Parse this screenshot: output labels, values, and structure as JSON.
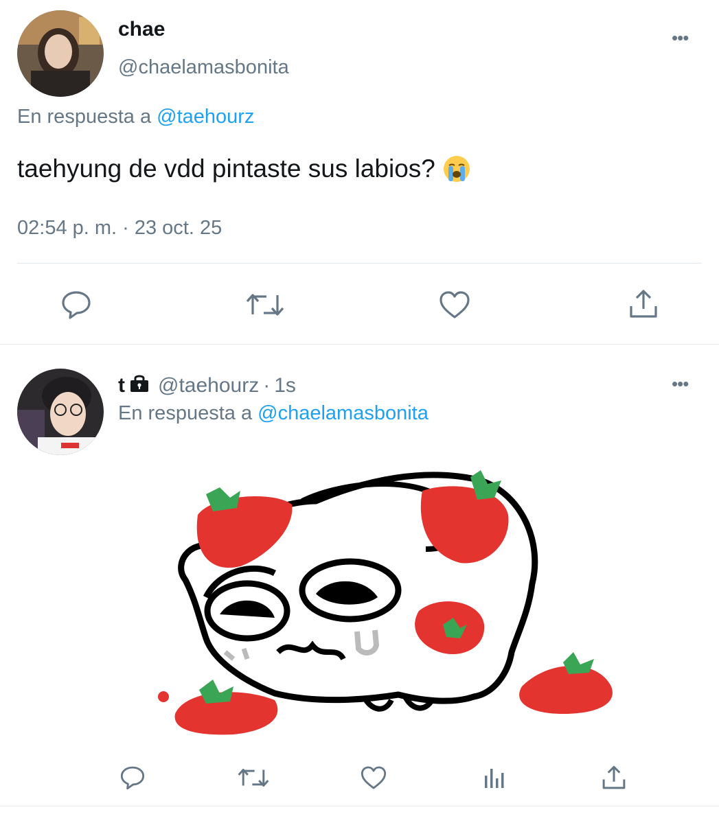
{
  "main_tweet": {
    "author_name": "chae",
    "author_handle": "@chaelamasbonita",
    "reply_prefix": "En respuesta a",
    "reply_to": "@taehourz",
    "text": "taehyung de vdd pintaste sus labios?",
    "emoji": "loudly-crying-face",
    "timestamp": "02:54 p. m. · 23 oct. 25",
    "more_label": "•••",
    "actions": [
      "reply-icon",
      "retweet-icon",
      "like-icon",
      "share-icon"
    ]
  },
  "reply_tweet": {
    "author_name": "t",
    "lock_icon": "lock-icon",
    "author_handle": "@taehourz",
    "separator": "·",
    "time_ago": "1s",
    "reply_prefix": "En respuesta a",
    "reply_to": "@chaelamasbonita",
    "more_label": "•••",
    "media": "strawberry-skull-drawing",
    "actions": [
      "reply-icon",
      "retweet-icon",
      "like-icon",
      "analytics-icon",
      "share-icon"
    ]
  },
  "colors": {
    "text": "#14171a",
    "secondary": "#657786",
    "link": "#1da1f2",
    "divider": "#e1e8ed",
    "strawberry": "#e3342f",
    "leaf": "#3aa655"
  }
}
